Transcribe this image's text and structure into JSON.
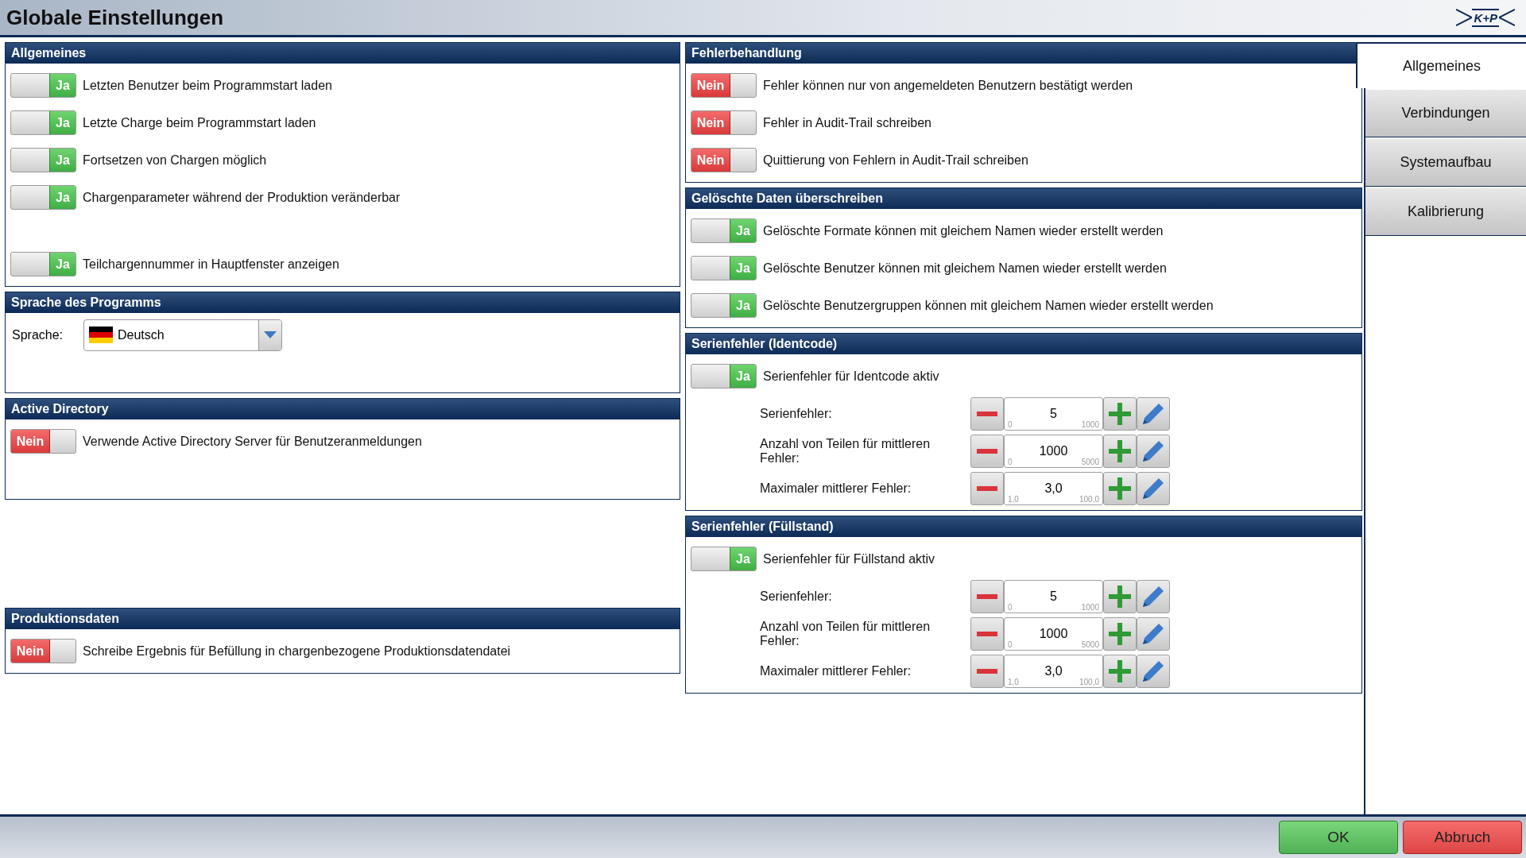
{
  "window": {
    "title": "Globale Einstellungen",
    "logo": "K+P"
  },
  "left_sections": [
    {
      "title": "Allgemeines",
      "toggles": [
        {
          "on": true,
          "label": "Ja",
          "text": "Letzten Benutzer beim Programmstart laden"
        },
        {
          "on": true,
          "label": "Ja",
          "text": "Letzte Charge beim Programmstart laden"
        },
        {
          "on": true,
          "label": "Ja",
          "text": "Fortsetzen von Chargen möglich"
        },
        {
          "on": true,
          "label": "Ja",
          "text": "Chargenparameter während der Produktion veränderbar"
        },
        {
          "on": true,
          "label": "Ja",
          "text": "Teilchargennummer in Hauptfenster anzeigen"
        }
      ]
    },
    {
      "title": "Sprache des Programms",
      "language": {
        "label": "Sprache:",
        "value": "Deutsch"
      }
    },
    {
      "title": "Active Directory",
      "toggles": [
        {
          "on": false,
          "label": "Nein",
          "text": "Verwende Active Directory Server für Benutzeranmeldungen"
        }
      ]
    },
    {
      "title": "Produktionsdaten",
      "toggles": [
        {
          "on": false,
          "label": "Nein",
          "text": "Schreibe Ergebnis für Befüllung in chargenbezogene Produktionsdatendatei"
        }
      ]
    }
  ],
  "right_sections": [
    {
      "title": "Fehlerbehandlung",
      "toggles": [
        {
          "on": false,
          "label": "Nein",
          "text": "Fehler können nur von angemeldeten Benutzern bestätigt werden"
        },
        {
          "on": false,
          "label": "Nein",
          "text": "Fehler in Audit-Trail schreiben"
        },
        {
          "on": false,
          "label": "Nein",
          "text": "Quittierung von Fehlern in Audit-Trail schreiben"
        }
      ]
    },
    {
      "title": "Gelöschte Daten überschreiben",
      "toggles": [
        {
          "on": true,
          "label": "Ja",
          "text": "Gelöschte Formate können mit gleichem Namen wieder erstellt werden"
        },
        {
          "on": true,
          "label": "Ja",
          "text": "Gelöschte Benutzer können mit gleichem Namen wieder erstellt werden"
        },
        {
          "on": true,
          "label": "Ja",
          "text": "Gelöschte Benutzergruppen können mit gleichem Namen wieder erstellt werden"
        }
      ]
    },
    {
      "title": "Serienfehler (Identcode)",
      "toggles": [
        {
          "on": true,
          "label": "Ja",
          "text": "Serienfehler für Identcode aktiv"
        }
      ],
      "spinners": [
        {
          "label": "Serienfehler:",
          "value": "5",
          "min": "0",
          "max": "1000"
        },
        {
          "label": "Anzahl von Teilen für mittleren Fehler:",
          "value": "1000",
          "min": "0",
          "max": "5000"
        },
        {
          "label": "Maximaler mittlerer Fehler:",
          "value": "3,0",
          "min": "1,0",
          "max": "100,0"
        }
      ]
    },
    {
      "title": "Serienfehler (Füllstand)",
      "toggles": [
        {
          "on": true,
          "label": "Ja",
          "text": "Serienfehler für Füllstand aktiv"
        }
      ],
      "spinners": [
        {
          "label": "Serienfehler:",
          "value": "5",
          "min": "0",
          "max": "1000"
        },
        {
          "label": "Anzahl von Teilen für mittleren Fehler:",
          "value": "1000",
          "min": "0",
          "max": "5000"
        },
        {
          "label": "Maximaler mittlerer Fehler:",
          "value": "3,0",
          "min": "1,0",
          "max": "100,0"
        }
      ]
    }
  ],
  "tabs": [
    {
      "label": "Allgemeines",
      "selected": true
    },
    {
      "label": "Verbindungen",
      "selected": false
    },
    {
      "label": "Systemaufbau",
      "selected": false
    },
    {
      "label": "Kalibrierung",
      "selected": false
    }
  ],
  "buttons": {
    "ok": "OK",
    "cancel": "Abbruch"
  }
}
